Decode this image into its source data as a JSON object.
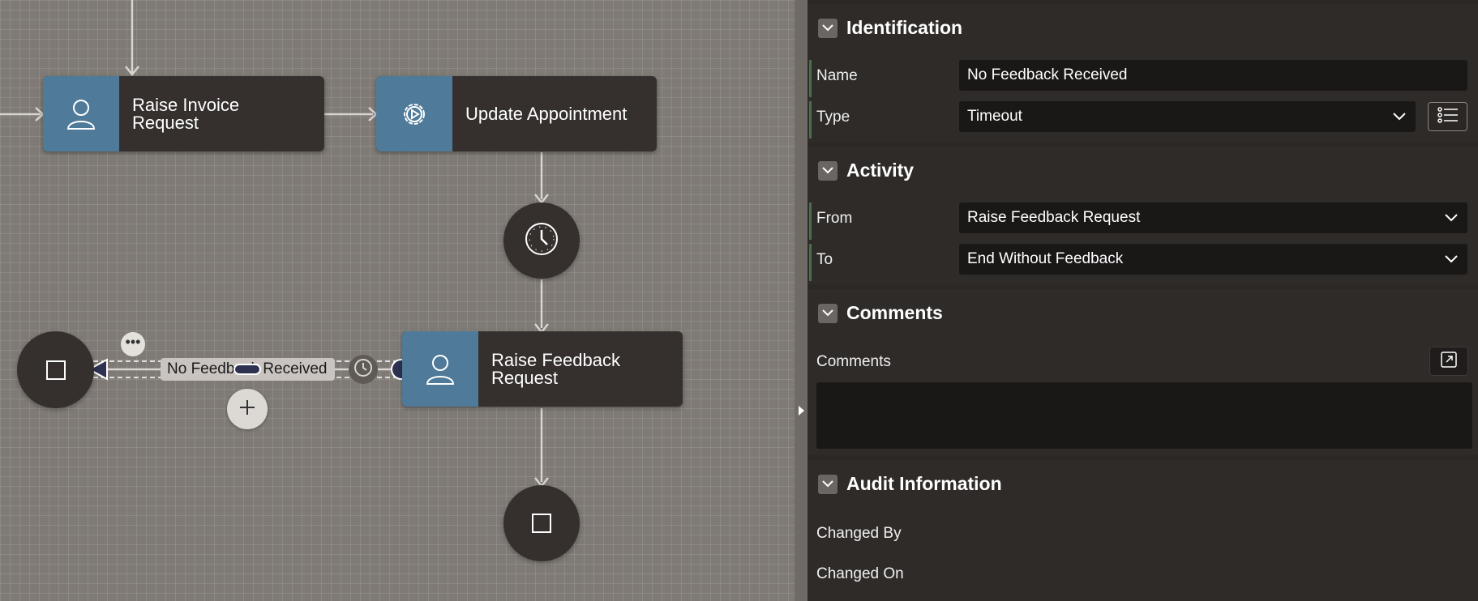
{
  "canvas": {
    "nodes": {
      "raise_invoice": {
        "label": "Raise Invoice Request",
        "icon": "user-icon"
      },
      "update_appointment": {
        "label": "Update Appointment",
        "icon": "gear-play-icon"
      },
      "raise_feedback": {
        "label": "Raise Feedback Request",
        "icon": "user-icon"
      }
    },
    "timer_event": {
      "icon": "clock-icon"
    },
    "end_events": [
      {
        "icon": "stop-icon"
      },
      {
        "icon": "stop-icon"
      }
    ],
    "selected_connection": {
      "label": "No Feedback Received"
    }
  },
  "panel": {
    "identification": {
      "title": "Identification",
      "name_label": "Name",
      "name_value": "No Feedback Received",
      "type_label": "Type",
      "type_value": "Timeout"
    },
    "activity": {
      "title": "Activity",
      "from_label": "From",
      "from_value": "Raise Feedback Request",
      "to_label": "To",
      "to_value": "End Without Feedback"
    },
    "comments": {
      "title": "Comments",
      "field_label": "Comments",
      "value": ""
    },
    "audit": {
      "title": "Audit Information",
      "changed_by_label": "Changed By",
      "changed_on_label": "Changed On"
    }
  },
  "colors": {
    "canvas_bg": "#7f7a75",
    "node_bg": "#35302d",
    "node_icon_bg": "#4f7a99",
    "panel_bg": "#2b2826",
    "field_bg": "#1a1817",
    "selection": "#2e3150"
  }
}
